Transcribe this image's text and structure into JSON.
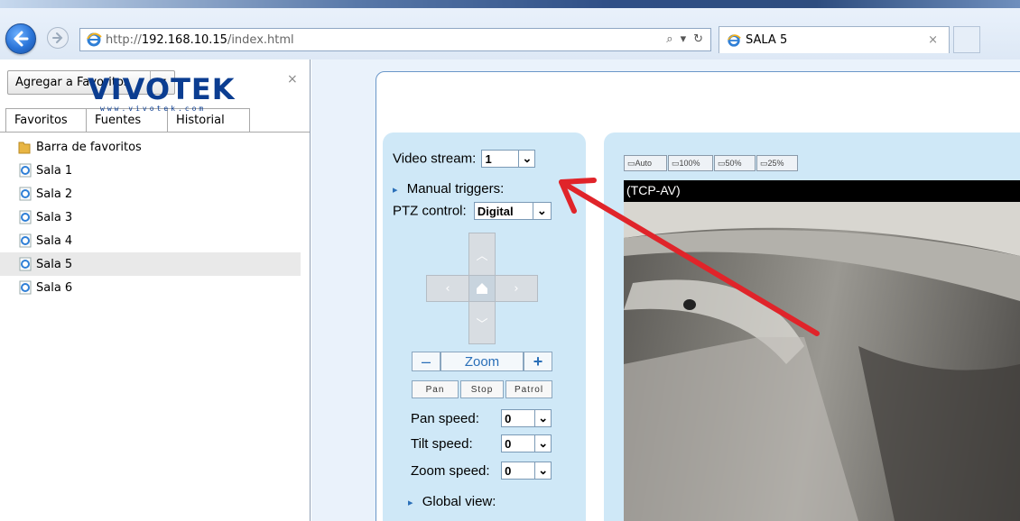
{
  "browser": {
    "url_prefix": "http://",
    "url_host": "192.168.10.15",
    "url_path": "/index.html",
    "search_glyph": "⌕",
    "refresh_glyph": "↻",
    "tab_title": "SALA 5",
    "tab_close": "×"
  },
  "favorites": {
    "add_button": "Agregar a Favoritos",
    "close": "×",
    "tabs": [
      "Favoritos",
      "Fuentes",
      "Historial"
    ],
    "items": [
      {
        "label": "Barra de favoritos",
        "type": "folder"
      },
      {
        "label": "Sala 1",
        "type": "page"
      },
      {
        "label": "Sala 2",
        "type": "page"
      },
      {
        "label": "Sala 3",
        "type": "page"
      },
      {
        "label": "Sala 4",
        "type": "page"
      },
      {
        "label": "Sala 5",
        "type": "page",
        "selected": true
      },
      {
        "label": "Sala 6",
        "type": "page"
      }
    ]
  },
  "vivotek": {
    "logo_text": "VIVOTEK",
    "logo_url": "www.vivotek.com",
    "video_stream_label": "Video stream:",
    "video_stream_value": "1",
    "manual_triggers_label": "Manual triggers:",
    "ptz_control_label": "PTZ control:",
    "ptz_control_value": "Digital",
    "zoom_label": "Zoom",
    "zoom_minus": "–",
    "zoom_plus": "+",
    "pan_button": "Pan",
    "stop_button": "Stop",
    "patrol_button": "Patrol",
    "pan_speed_label": "Pan speed:",
    "pan_speed_value": "0",
    "tilt_speed_label": "Tilt speed:",
    "tilt_speed_value": "0",
    "zoom_speed_label": "Zoom speed:",
    "zoom_speed_value": "0",
    "global_view_label": "Global view:",
    "size_buttons": [
      "Auto",
      "100%",
      "50%",
      "25%"
    ],
    "video_header": "(TCP-AV)"
  },
  "colors": {
    "panel_bg": "#cfe8f7",
    "logo_blue": "#0b3d91",
    "annotation_red": "#e0242a"
  }
}
